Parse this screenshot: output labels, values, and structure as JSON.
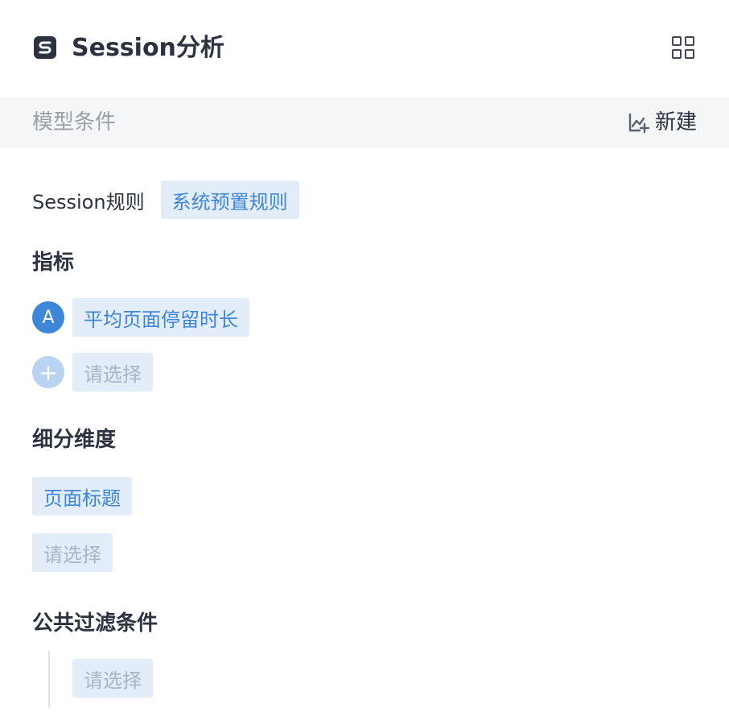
{
  "header": {
    "logo_letter": "S",
    "title": "Session分析",
    "layout_icon": "grid-icon"
  },
  "model_conditions": {
    "title": "模型条件",
    "new_icon": "chart-add-icon",
    "new_label": "新建"
  },
  "session_rule": {
    "label": "Session规则",
    "value": "系统预置规则"
  },
  "metrics": {
    "heading": "指标",
    "items": [
      {
        "badge": "A",
        "value": "平均页面停留时长"
      }
    ],
    "add_badge": "+",
    "add_placeholder": "请选择"
  },
  "breakdown": {
    "heading": "细分维度",
    "items": [
      "页面标题"
    ],
    "placeholder": "请选择"
  },
  "filters": {
    "heading": "公共过滤条件",
    "placeholder": "请选择"
  },
  "colors": {
    "accent": "#3d86d8",
    "chip_bg": "#e3edf9",
    "text_primary": "#2b3340",
    "text_muted": "#9aa1ab",
    "section_bg": "#f5f6f8"
  }
}
